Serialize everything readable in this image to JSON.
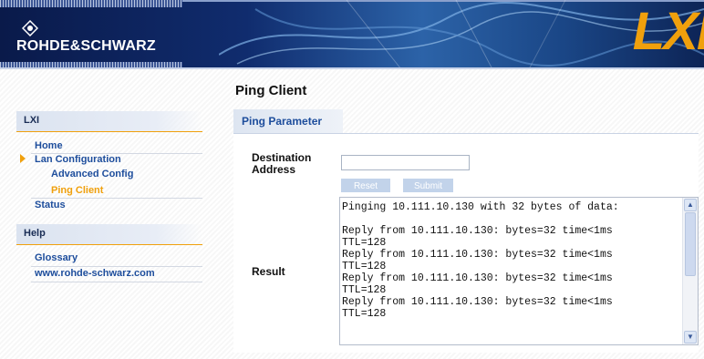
{
  "header": {
    "brand": "ROHDE&SCHWARZ",
    "lxi_logo": "LXI",
    "accent_color": "#f0a00c"
  },
  "sidebar": {
    "section_lxi": "LXI",
    "items_lxi": [
      {
        "label": "Home"
      },
      {
        "label": "Lan Configuration"
      },
      {
        "label": "Advanced Config"
      },
      {
        "label": "Ping Client"
      },
      {
        "label": "Status"
      }
    ],
    "section_help": "Help",
    "items_help": [
      {
        "label": "Glossary"
      },
      {
        "label": "www.rohde-schwarz.com"
      }
    ]
  },
  "main": {
    "title": "Ping Client",
    "tab_label": "Ping Parameter",
    "dest_label_line1": "Destination",
    "dest_label_line2": "Address",
    "dest_value": "",
    "reset_label": "Reset",
    "submit_label": "Submit",
    "result_label": "Result",
    "result_text": "Pinging 10.111.10.130 with 32 bytes of data:\n\nReply from 10.111.10.130: bytes=32 time<1ms\nTTL=128\nReply from 10.111.10.130: bytes=32 time<1ms\nTTL=128\nReply from 10.111.10.130: bytes=32 time<1ms\nTTL=128\nReply from 10.111.10.130: bytes=32 time<1ms\nTTL=128"
  },
  "icons": {
    "scroll_up": "scroll-up-arrow-icon",
    "scroll_down": "scroll-down-arrow-icon",
    "nav_arrow": "nav-arrow-icon",
    "emblem": "rs-emblem-icon"
  }
}
